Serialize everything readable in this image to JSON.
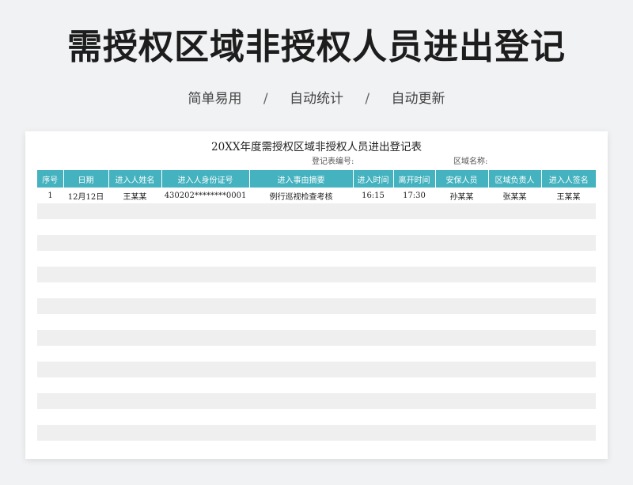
{
  "header": {
    "title": "需授权区域非授权人员进出登记",
    "subtitle": [
      "简单易用",
      "自动统计",
      "自动更新"
    ],
    "separator": "/"
  },
  "sheet": {
    "title": "20XX年度需授权区域非授权人员进出登记表",
    "code_label": "登记表编号:",
    "area_label": "区域名称:",
    "columns": [
      "序号",
      "日期",
      "进入人姓名",
      "进入人身份证号",
      "进入事由摘要",
      "进入时间",
      "离开时间",
      "安保人员",
      "区域负责人",
      "进入人签名"
    ],
    "rows": [
      [
        "1",
        "12月12日",
        "王某某",
        "430202********0001",
        "例行巡视检查考核",
        "16:15",
        "17:30",
        "孙某某",
        "张某某",
        "王某某"
      ],
      [
        "",
        "",
        "",
        "",
        "",
        "",
        "",
        "",
        "",
        ""
      ],
      [
        "",
        "",
        "",
        "",
        "",
        "",
        "",
        "",
        "",
        ""
      ],
      [
        "",
        "",
        "",
        "",
        "",
        "",
        "",
        "",
        "",
        ""
      ],
      [
        "",
        "",
        "",
        "",
        "",
        "",
        "",
        "",
        "",
        ""
      ],
      [
        "",
        "",
        "",
        "",
        "",
        "",
        "",
        "",
        "",
        ""
      ],
      [
        "",
        "",
        "",
        "",
        "",
        "",
        "",
        "",
        "",
        ""
      ],
      [
        "",
        "",
        "",
        "",
        "",
        "",
        "",
        "",
        "",
        ""
      ],
      [
        "",
        "",
        "",
        "",
        "",
        "",
        "",
        "",
        "",
        ""
      ],
      [
        "",
        "",
        "",
        "",
        "",
        "",
        "",
        "",
        "",
        ""
      ],
      [
        "",
        "",
        "",
        "",
        "",
        "",
        "",
        "",
        "",
        ""
      ],
      [
        "",
        "",
        "",
        "",
        "",
        "",
        "",
        "",
        "",
        ""
      ],
      [
        "",
        "",
        "",
        "",
        "",
        "",
        "",
        "",
        "",
        ""
      ],
      [
        "",
        "",
        "",
        "",
        "",
        "",
        "",
        "",
        "",
        ""
      ],
      [
        "",
        "",
        "",
        "",
        "",
        "",
        "",
        "",
        "",
        ""
      ],
      [
        "",
        "",
        "",
        "",
        "",
        "",
        "",
        "",
        "",
        ""
      ]
    ]
  },
  "colors": {
    "header_bg": "#44b2bf",
    "stripe": "#efefef",
    "page_bg": "#f1f2f4"
  }
}
